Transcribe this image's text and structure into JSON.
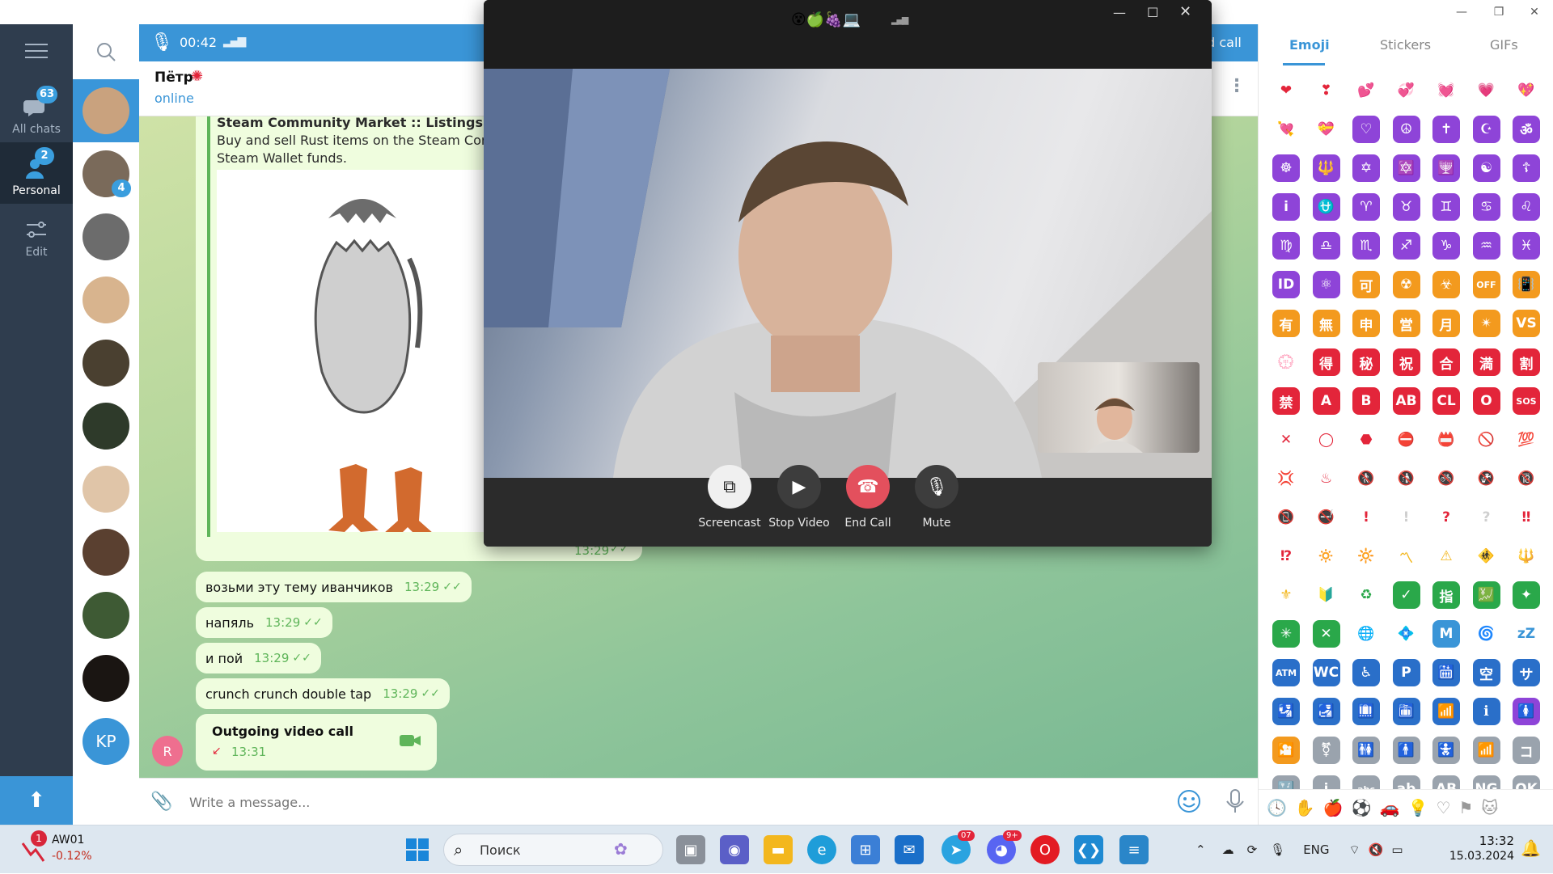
{
  "window": {
    "minimize": "—",
    "maximize": "❐",
    "close": "✕"
  },
  "folders": [
    {
      "label": "All chats",
      "badge": "63"
    },
    {
      "label": "Personal",
      "badge": "2"
    },
    {
      "label": "Edit"
    }
  ],
  "chat_list": {
    "avatars": [
      {
        "initials": "",
        "color": "#c9a27e"
      },
      {
        "initials": "",
        "color": "#7a6a5a",
        "badge": "4"
      },
      {
        "initials": "",
        "color": "#6c6c6c"
      },
      {
        "initials": "",
        "color": "#d8b48e"
      },
      {
        "initials": "",
        "color": "#4a4030"
      },
      {
        "initials": "",
        "color": "#2e3a2a"
      },
      {
        "initials": "",
        "color": "#e0c5a8"
      },
      {
        "initials": "",
        "color": "#5a4030"
      },
      {
        "initials": "",
        "color": "#3e5a34"
      },
      {
        "initials": "",
        "color": "#1a1512"
      },
      {
        "initials": "KP",
        "color": "#3a95d7"
      }
    ]
  },
  "call_bar": {
    "timer": "00:42",
    "end_call_label": "nd call"
  },
  "chat_header": {
    "name": "Пётр",
    "status": "online"
  },
  "link_preview": {
    "title": "Steam Community Market :: Listings for Egg",
    "description_line1": "Buy and sell Rust items on the Steam Comm",
    "description_line2": "Steam Wallet funds.",
    "time": "13:29"
  },
  "messages": [
    {
      "text": "возьми эту тему иванчиков",
      "time": "13:29"
    },
    {
      "text": "напяль",
      "time": "13:29"
    },
    {
      "text": "и пой",
      "time": "13:29"
    },
    {
      "text": "crunch crunch double tap",
      "time": "13:29"
    }
  ],
  "call_message": {
    "title": "Outgoing video call",
    "time": "13:31",
    "sender_initial": "R"
  },
  "input": {
    "placeholder": "Write a message..."
  },
  "emoji_panel": {
    "tabs": [
      "Emoji",
      "Stickers",
      "GIFs"
    ],
    "cells": [
      {
        "g": "❤",
        "c": "#ffffff",
        "fg": "#e3253a"
      },
      {
        "g": "❣",
        "c": "#ffffff",
        "fg": "#e3253a"
      },
      {
        "g": "💕",
        "c": "#ffffff",
        "fg": "#ee5ca8"
      },
      {
        "g": "💞",
        "c": "#ffffff",
        "fg": "#ee5ca8"
      },
      {
        "g": "💓",
        "c": "#ffffff",
        "fg": "#ee5ca8"
      },
      {
        "g": "💗",
        "c": "#ffffff",
        "fg": "#ee5ca8"
      },
      {
        "g": "💖",
        "c": "#ffffff",
        "fg": "#ee5ca8"
      },
      {
        "g": "💘",
        "c": "#ffffff",
        "fg": "#ee5ca8"
      },
      {
        "g": "💝",
        "c": "#ffffff",
        "fg": "#ee5ca8"
      },
      {
        "g": "♡",
        "c": "#8e44d8",
        "fg": "#fff"
      },
      {
        "g": "☮",
        "c": "#8e44d8",
        "fg": "#fff"
      },
      {
        "g": "✝",
        "c": "#8e44d8",
        "fg": "#fff"
      },
      {
        "g": "☪",
        "c": "#8e44d8",
        "fg": "#fff"
      },
      {
        "g": "ॐ",
        "c": "#8e44d8",
        "fg": "#fff"
      },
      {
        "g": "☸",
        "c": "#8e44d8",
        "fg": "#fff"
      },
      {
        "g": "🔱",
        "c": "#8e44d8",
        "fg": "#fff"
      },
      {
        "g": "✡",
        "c": "#8e44d8",
        "fg": "#fff"
      },
      {
        "g": "🔯",
        "c": "#8e44d8",
        "fg": "#fff"
      },
      {
        "g": "🕎",
        "c": "#8e44d8",
        "fg": "#fff"
      },
      {
        "g": "☯",
        "c": "#8e44d8",
        "fg": "#fff"
      },
      {
        "g": "☦",
        "c": "#8e44d8",
        "fg": "#fff"
      },
      {
        "g": "i",
        "c": "#8e44d8",
        "fg": "#fff"
      },
      {
        "g": "⛎",
        "c": "#8e44d8",
        "fg": "#fff"
      },
      {
        "g": "♈",
        "c": "#8e44d8",
        "fg": "#fff"
      },
      {
        "g": "♉",
        "c": "#8e44d8",
        "fg": "#fff"
      },
      {
        "g": "♊",
        "c": "#8e44d8",
        "fg": "#fff"
      },
      {
        "g": "♋",
        "c": "#8e44d8",
        "fg": "#fff"
      },
      {
        "g": "♌",
        "c": "#8e44d8",
        "fg": "#fff"
      },
      {
        "g": "♍",
        "c": "#8e44d8",
        "fg": "#fff"
      },
      {
        "g": "♎",
        "c": "#8e44d8",
        "fg": "#fff"
      },
      {
        "g": "♏",
        "c": "#8e44d8",
        "fg": "#fff"
      },
      {
        "g": "♐",
        "c": "#8e44d8",
        "fg": "#fff"
      },
      {
        "g": "♑",
        "c": "#8e44d8",
        "fg": "#fff"
      },
      {
        "g": "♒",
        "c": "#8e44d8",
        "fg": "#fff"
      },
      {
        "g": "♓",
        "c": "#8e44d8",
        "fg": "#fff"
      },
      {
        "g": "ID",
        "c": "#8e44d8",
        "fg": "#fff"
      },
      {
        "g": "⚛",
        "c": "#8e44d8",
        "fg": "#fff"
      },
      {
        "g": "可",
        "c": "#f39a1e",
        "fg": "#fff"
      },
      {
        "g": "☢",
        "c": "#f39a1e",
        "fg": "#fff"
      },
      {
        "g": "☣",
        "c": "#f39a1e",
        "fg": "#fff"
      },
      {
        "g": "OFF",
        "c": "#f39a1e",
        "fg": "#fff"
      },
      {
        "g": "📳",
        "c": "#f39a1e",
        "fg": "#fff"
      },
      {
        "g": "有",
        "c": "#f39a1e",
        "fg": "#fff"
      },
      {
        "g": "無",
        "c": "#f39a1e",
        "fg": "#fff"
      },
      {
        "g": "申",
        "c": "#f39a1e",
        "fg": "#fff"
      },
      {
        "g": "営",
        "c": "#f39a1e",
        "fg": "#fff"
      },
      {
        "g": "月",
        "c": "#f39a1e",
        "fg": "#fff"
      },
      {
        "g": "✴",
        "c": "#f39a1e",
        "fg": "#fff"
      },
      {
        "g": "VS",
        "c": "#f39a1e",
        "fg": "#fff"
      },
      {
        "g": "💮",
        "c": "#ffffff",
        "fg": "#e3253a"
      },
      {
        "g": "得",
        "c": "#e3253a",
        "fg": "#fff"
      },
      {
        "g": "秘",
        "c": "#e3253a",
        "fg": "#fff"
      },
      {
        "g": "祝",
        "c": "#e3253a",
        "fg": "#fff"
      },
      {
        "g": "合",
        "c": "#e3253a",
        "fg": "#fff"
      },
      {
        "g": "満",
        "c": "#e3253a",
        "fg": "#fff"
      },
      {
        "g": "割",
        "c": "#e3253a",
        "fg": "#fff"
      },
      {
        "g": "禁",
        "c": "#e3253a",
        "fg": "#fff"
      },
      {
        "g": "A",
        "c": "#e3253a",
        "fg": "#fff"
      },
      {
        "g": "B",
        "c": "#e3253a",
        "fg": "#fff"
      },
      {
        "g": "AB",
        "c": "#e3253a",
        "fg": "#fff"
      },
      {
        "g": "CL",
        "c": "#e3253a",
        "fg": "#fff"
      },
      {
        "g": "O",
        "c": "#e3253a",
        "fg": "#fff"
      },
      {
        "g": "SOS",
        "c": "#e3253a",
        "fg": "#fff"
      },
      {
        "g": "✕",
        "c": "#ffffff",
        "fg": "#e3253a"
      },
      {
        "g": "◯",
        "c": "#ffffff",
        "fg": "#e3253a"
      },
      {
        "g": "⬣",
        "c": "#ffffff",
        "fg": "#e3253a"
      },
      {
        "g": "⛔",
        "c": "#ffffff",
        "fg": "#e3253a"
      },
      {
        "g": "📛",
        "c": "#ffffff",
        "fg": "#e3253a"
      },
      {
        "g": "🚫",
        "c": "#ffffff",
        "fg": "#e3253a"
      },
      {
        "g": "💯",
        "c": "#ffffff",
        "fg": "#e3253a"
      },
      {
        "g": "💢",
        "c": "#ffffff",
        "fg": "#e3253a"
      },
      {
        "g": "♨",
        "c": "#ffffff",
        "fg": "#e3253a"
      },
      {
        "g": "🚷",
        "c": "#ffffff",
        "fg": "#e3253a"
      },
      {
        "g": "🚯",
        "c": "#ffffff",
        "fg": "#e3253a"
      },
      {
        "g": "🚳",
        "c": "#ffffff",
        "fg": "#e3253a"
      },
      {
        "g": "🚱",
        "c": "#ffffff",
        "fg": "#e3253a"
      },
      {
        "g": "🔞",
        "c": "#ffffff",
        "fg": "#e3253a"
      },
      {
        "g": "📵",
        "c": "#ffffff",
        "fg": "#e3253a"
      },
      {
        "g": "🚭",
        "c": "#ffffff",
        "fg": "#e3253a"
      },
      {
        "g": "!",
        "c": "#ffffff",
        "fg": "#e3253a"
      },
      {
        "g": "!",
        "c": "#ffffff",
        "fg": "#cfcfcf"
      },
      {
        "g": "?",
        "c": "#ffffff",
        "fg": "#e3253a"
      },
      {
        "g": "?",
        "c": "#ffffff",
        "fg": "#cfcfcf"
      },
      {
        "g": "‼",
        "c": "#ffffff",
        "fg": "#e3253a"
      },
      {
        "g": "⁉",
        "c": "#ffffff",
        "fg": "#e3253a"
      },
      {
        "g": "🔅",
        "c": "#ffffff",
        "fg": "#f3b71e"
      },
      {
        "g": "🔆",
        "c": "#ffffff",
        "fg": "#f3b71e"
      },
      {
        "g": "〽",
        "c": "#ffffff",
        "fg": "#f3b71e"
      },
      {
        "g": "⚠",
        "c": "#ffffff",
        "fg": "#f3b71e"
      },
      {
        "g": "🚸",
        "c": "#ffffff",
        "fg": "#f3b71e"
      },
      {
        "g": "🔱",
        "c": "#ffffff",
        "fg": "#f3b71e"
      },
      {
        "g": "⚜",
        "c": "#ffffff",
        "fg": "#f3b71e"
      },
      {
        "g": "🔰",
        "c": "#ffffff",
        "fg": "#2aa84a"
      },
      {
        "g": "♻",
        "c": "#ffffff",
        "fg": "#2aa84a"
      },
      {
        "g": "✓",
        "c": "#2aa84a",
        "fg": "#fff"
      },
      {
        "g": "指",
        "c": "#2aa84a",
        "fg": "#fff"
      },
      {
        "g": "💹",
        "c": "#2aa84a",
        "fg": "#fff"
      },
      {
        "g": "✦",
        "c": "#2aa84a",
        "fg": "#fff"
      },
      {
        "g": "✳",
        "c": "#2aa84a",
        "fg": "#fff"
      },
      {
        "g": "✕",
        "c": "#2aa84a",
        "fg": "#fff"
      },
      {
        "g": "🌐",
        "c": "#ffffff",
        "fg": "#3a95d7"
      },
      {
        "g": "💠",
        "c": "#ffffff",
        "fg": "#3a95d7"
      },
      {
        "g": "M",
        "c": "#3a95d7",
        "fg": "#fff"
      },
      {
        "g": "🌀",
        "c": "#ffffff",
        "fg": "#3a95d7"
      },
      {
        "g": "zZ",
        "c": "#ffffff",
        "fg": "#3a95d7"
      },
      {
        "g": "ATM",
        "c": "#2a6fc9",
        "fg": "#fff"
      },
      {
        "g": "WC",
        "c": "#2a6fc9",
        "fg": "#fff"
      },
      {
        "g": "♿",
        "c": "#2a6fc9",
        "fg": "#fff"
      },
      {
        "g": "P",
        "c": "#2a6fc9",
        "fg": "#fff"
      },
      {
        "g": "🛗",
        "c": "#2a6fc9",
        "fg": "#fff"
      },
      {
        "g": "空",
        "c": "#2a6fc9",
        "fg": "#fff"
      },
      {
        "g": "サ",
        "c": "#2a6fc9",
        "fg": "#fff"
      },
      {
        "g": "🛂",
        "c": "#2a6fc9",
        "fg": "#fff"
      },
      {
        "g": "🛃",
        "c": "#2a6fc9",
        "fg": "#fff"
      },
      {
        "g": "🛄",
        "c": "#2a6fc9",
        "fg": "#fff"
      },
      {
        "g": "🛅",
        "c": "#2a6fc9",
        "fg": "#fff"
      },
      {
        "g": "📶",
        "c": "#2a6fc9",
        "fg": "#fff"
      },
      {
        "g": "ℹ",
        "c": "#2a6fc9",
        "fg": "#fff"
      },
      {
        "g": "🚺",
        "c": "#8e44d8",
        "fg": "#fff"
      },
      {
        "g": "🎦",
        "c": "#f39a1e",
        "fg": "#fff"
      },
      {
        "g": "⚧",
        "c": "#9aa3ad",
        "fg": "#fff"
      },
      {
        "g": "🚻",
        "c": "#9aa3ad",
        "fg": "#fff"
      },
      {
        "g": "🚹",
        "c": "#9aa3ad",
        "fg": "#fff"
      },
      {
        "g": "🚼",
        "c": "#9aa3ad",
        "fg": "#fff"
      },
      {
        "g": "📶",
        "c": "#9aa3ad",
        "fg": "#fff"
      },
      {
        "g": "コ",
        "c": "#9aa3ad",
        "fg": "#fff"
      },
      {
        "g": "🔣",
        "c": "#9aa3ad",
        "fg": "#fff"
      },
      {
        "g": "i",
        "c": "#9aa3ad",
        "fg": "#fff"
      },
      {
        "g": "abc",
        "c": "#9aa3ad",
        "fg": "#fff"
      },
      {
        "g": "ab",
        "c": "#9aa3ad",
        "fg": "#fff"
      },
      {
        "g": "AB",
        "c": "#9aa3ad",
        "fg": "#fff"
      },
      {
        "g": "NG",
        "c": "#9aa3ad",
        "fg": "#fff"
      },
      {
        "g": "OK",
        "c": "#9aa3ad",
        "fg": "#fff"
      }
    ]
  },
  "call_window": {
    "title_emoji": "😵🍏🍇💻",
    "buttons": [
      {
        "label": "Screencast"
      },
      {
        "label": "Stop Video"
      },
      {
        "label": "End Call"
      },
      {
        "label": "Mute"
      }
    ]
  },
  "taskbar": {
    "stock_ticker": "AW01",
    "stock_change": "-0.12%",
    "stock_badge": "1",
    "search_placeholder": "Поиск",
    "telegram_badge": "07",
    "discord_badge": "9+",
    "language": "ENG",
    "time": "13:32",
    "date": "15.03.2024"
  }
}
